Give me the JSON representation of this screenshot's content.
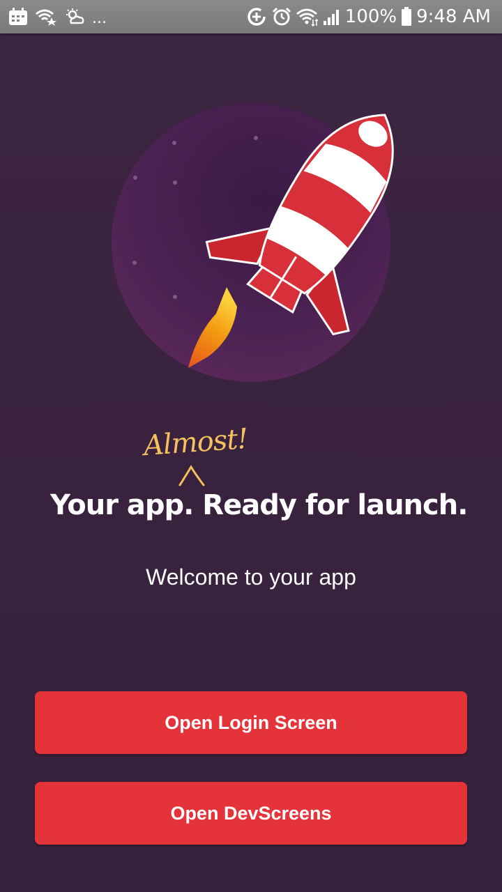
{
  "status_bar": {
    "left_icons": [
      "calendar-icon",
      "wifi-star-icon",
      "weather-icon"
    ],
    "overflow_label": "...",
    "right_icons": [
      "data-saver-icon",
      "alarm-icon",
      "wifi-icon",
      "signal-icon"
    ],
    "battery_percent": "100%",
    "time": "9:48 AM"
  },
  "hero": {
    "illustration": "rocket-illustration",
    "colors": {
      "circle": "#4a2350",
      "rocket_red": "#d7303a",
      "rocket_white": "#ffffff",
      "flame": "#f39c12"
    }
  },
  "annotation": {
    "text": "Almost!",
    "color": "#f4c060"
  },
  "headline": "Your app. Ready for launch.",
  "welcome_text": "Welcome to your app",
  "buttons": {
    "login": "Open Login Screen",
    "devscreens": "Open DevScreens"
  },
  "colors": {
    "background": "#3b2440",
    "button": "#e5333a",
    "status_bar": "#808080"
  }
}
